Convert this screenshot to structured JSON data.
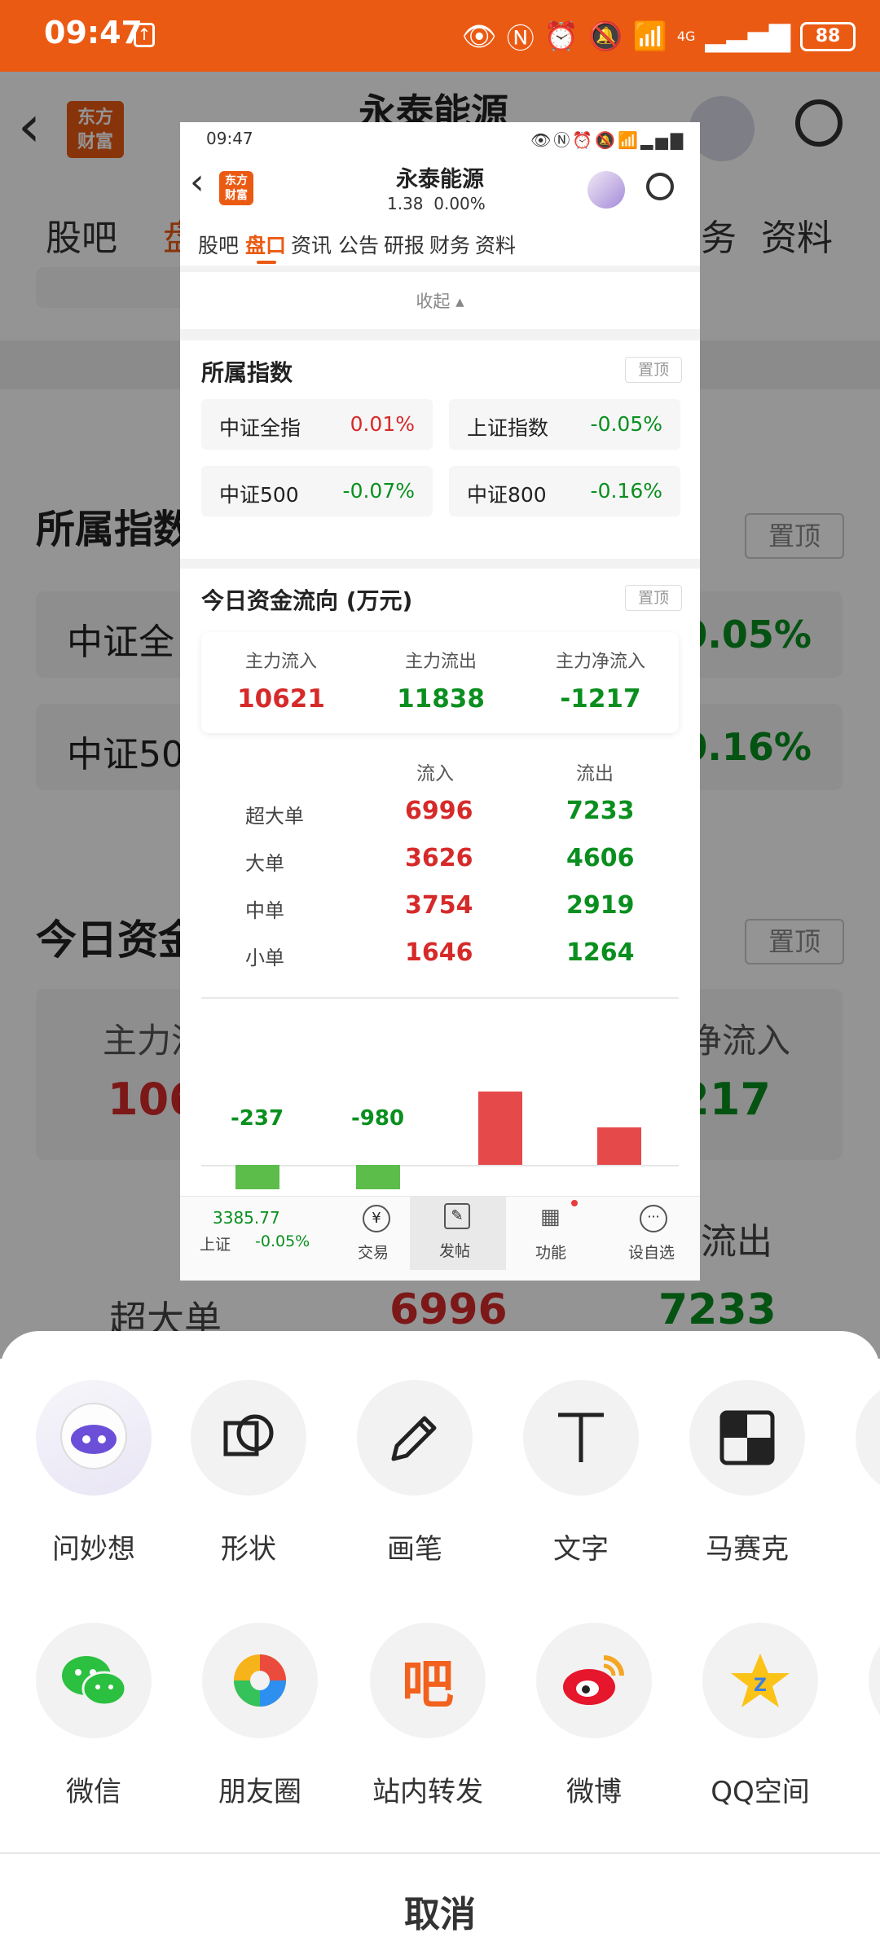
{
  "status_bar": {
    "time": "09:47",
    "battery": "88",
    "net": "4G"
  },
  "background": {
    "title": "永泰能源",
    "tabs": [
      "股吧",
      "盘",
      "资料"
    ],
    "tab_partial": "务",
    "section_index": "所属指数",
    "pin": "置顶",
    "row1_left": "中证全",
    "row1_right": "-0.05%",
    "row2_left": "中证50",
    "row2_right": "-0.16%",
    "section_flow": "今日资金",
    "flow_left_label": "主力流",
    "flow_left_value": "106",
    "flow_right_label": "净流入",
    "flow_right_value": "217",
    "out_label": "流出",
    "big_label": "超大单",
    "big_in": "6996",
    "big_out": "7233"
  },
  "preview": {
    "status_time": "09:47",
    "title": "永泰能源",
    "price": "1.38",
    "change": "0.00%",
    "logo": "东方财富",
    "tabs": [
      "股吧",
      "盘口",
      "资讯",
      "公告",
      "研报",
      "财务",
      "资料"
    ],
    "active_tab": "盘口",
    "collapse": "收起",
    "index_title": "所属指数",
    "pin": "置顶",
    "indices": [
      {
        "name": "中证全指",
        "value": "0.01%",
        "dir": "up"
      },
      {
        "name": "上证指数",
        "value": "-0.05%",
        "dir": "down"
      },
      {
        "name": "中证500",
        "value": "-0.07%",
        "dir": "down"
      },
      {
        "name": "中证800",
        "value": "-0.16%",
        "dir": "down"
      }
    ],
    "flow_title": "今日资金流向 (万元)",
    "summary": [
      {
        "label": "主力流入",
        "value": "10621",
        "dir": "up"
      },
      {
        "label": "主力流出",
        "value": "11838",
        "dir": "down"
      },
      {
        "label": "主力净流入",
        "value": "-1217",
        "dir": "down"
      }
    ],
    "table_head": {
      "in": "流入",
      "out": "流出"
    },
    "table": [
      {
        "name": "超大单",
        "in": "6996",
        "out": "7233"
      },
      {
        "name": "大单",
        "in": "3626",
        "out": "4606"
      },
      {
        "name": "中单",
        "in": "3754",
        "out": "2919"
      },
      {
        "name": "小单",
        "in": "1646",
        "out": "1264"
      }
    ],
    "bars": [
      {
        "label": "-237",
        "dir": "down"
      },
      {
        "label": "-980",
        "dir": "down"
      },
      {
        "label": "",
        "dir": "up"
      },
      {
        "label": "",
        "dir": "up"
      }
    ],
    "bottom": {
      "index_value": "3385.77",
      "index_name": "上证",
      "index_change": "-0.05%",
      "trade": "交易",
      "post": "发帖",
      "func": "功能",
      "watch": "设自选"
    }
  },
  "sheet": {
    "row1": [
      {
        "label": "问妙想",
        "icon": "robot-avatar-icon"
      },
      {
        "label": "形状",
        "icon": "shape-icon"
      },
      {
        "label": "画笔",
        "icon": "pen-icon"
      },
      {
        "label": "文字",
        "icon": "text-icon"
      },
      {
        "label": "马赛克",
        "icon": "mosaic-icon"
      }
    ],
    "row2": [
      {
        "label": "微信",
        "icon": "wechat-icon"
      },
      {
        "label": "朋友圈",
        "icon": "moments-icon"
      },
      {
        "label": "站内转发",
        "icon": "forward-icon"
      },
      {
        "label": "微博",
        "icon": "weibo-icon"
      },
      {
        "label": "QQ空间",
        "icon": "qzone-icon"
      }
    ],
    "forward_glyph": "吧",
    "cancel": "取消"
  },
  "colors": {
    "brand": "#eb5a13",
    "up": "#d62a2a",
    "down": "#0a8f1f"
  }
}
